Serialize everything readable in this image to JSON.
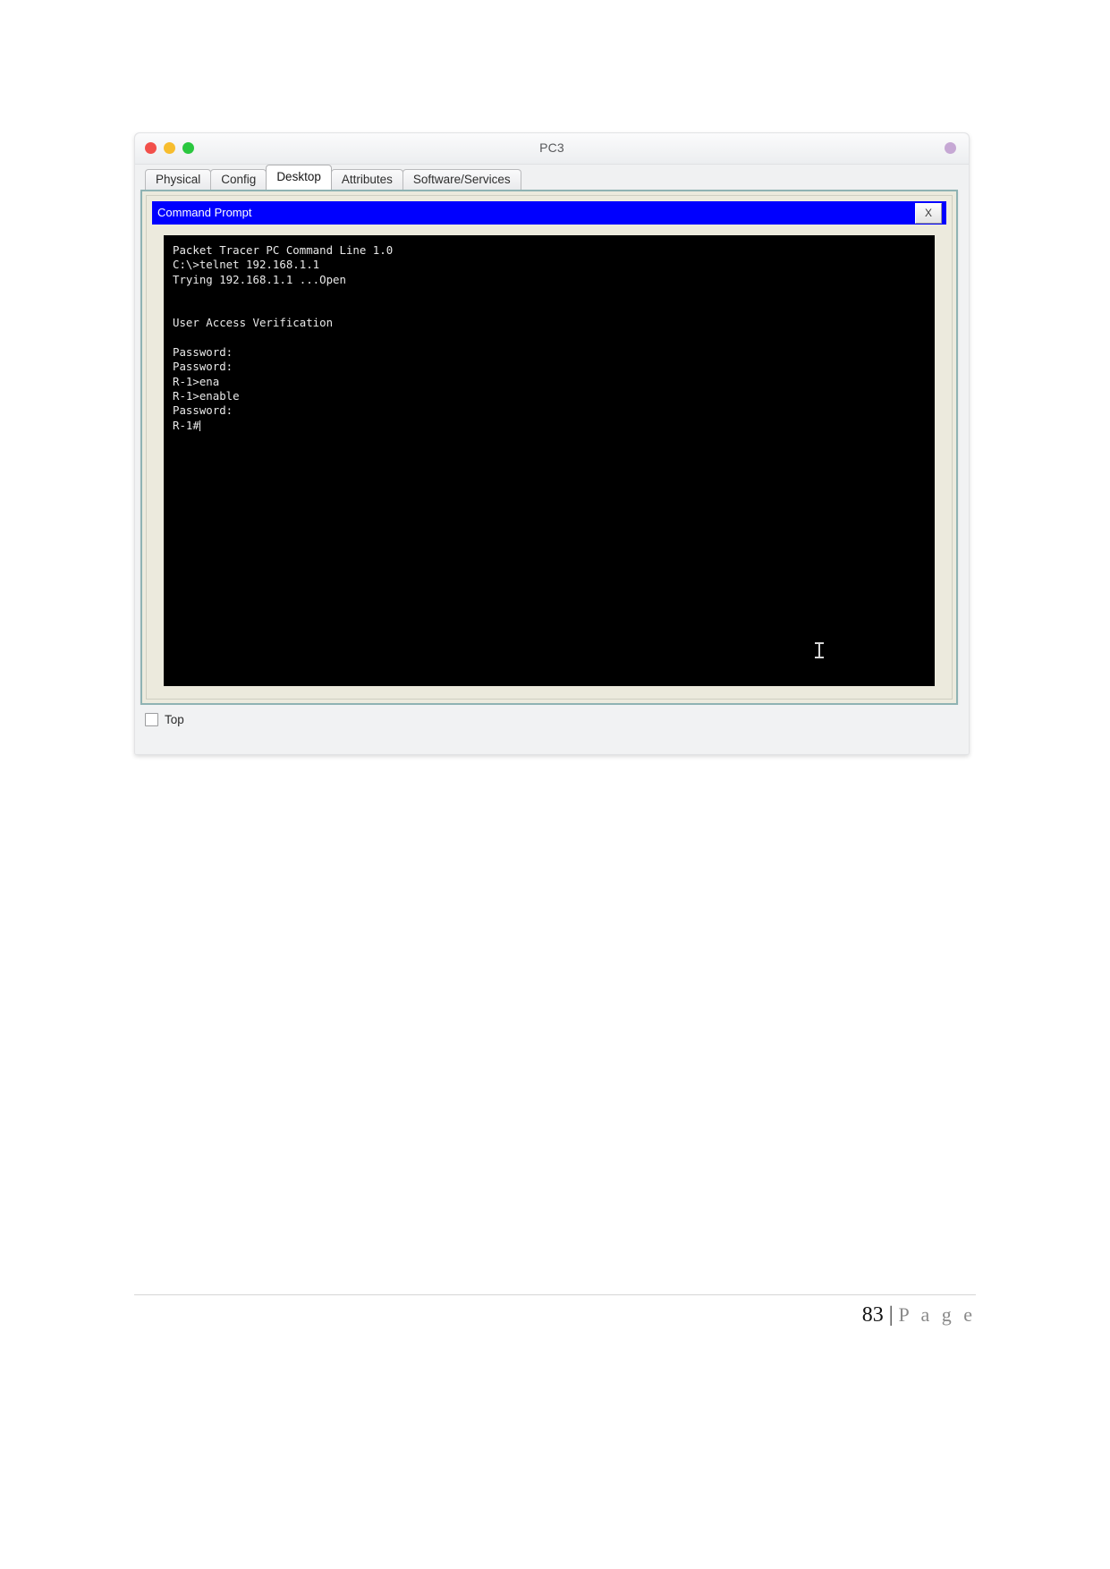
{
  "window": {
    "title": "PC3",
    "traffic_lights": [
      {
        "name": "close",
        "color": "#f2504b"
      },
      {
        "name": "minimize",
        "color": "#f7bd2e"
      },
      {
        "name": "zoom",
        "color": "#2ac73f"
      }
    ],
    "badge_color": "#c6a8d4"
  },
  "tabs": [
    {
      "label": "Physical",
      "active": false
    },
    {
      "label": "Config",
      "active": false
    },
    {
      "label": "Desktop",
      "active": true
    },
    {
      "label": "Attributes",
      "active": false
    },
    {
      "label": "Software/Services",
      "active": false
    }
  ],
  "command_prompt": {
    "title": "Command Prompt",
    "close_label": "X",
    "titlebar_color": "#0000ff",
    "terminal_bg": "#000000",
    "terminal_fg": "#e9e9e9",
    "lines": [
      "Packet Tracer PC Command Line 1.0",
      "C:\\>telnet 192.168.1.1",
      "Trying 192.168.1.1 ...Open",
      "",
      "",
      "User Access Verification",
      "",
      "Password:",
      "Password:",
      "R-1>ena",
      "R-1>enable",
      "Password:",
      "R-1#"
    ],
    "prompt_last": "R-1#"
  },
  "bottom": {
    "top_checkbox_label": "Top",
    "top_checkbox_checked": false
  },
  "footer": {
    "page_number": "83",
    "separator": "|",
    "page_word": "P a g e"
  }
}
